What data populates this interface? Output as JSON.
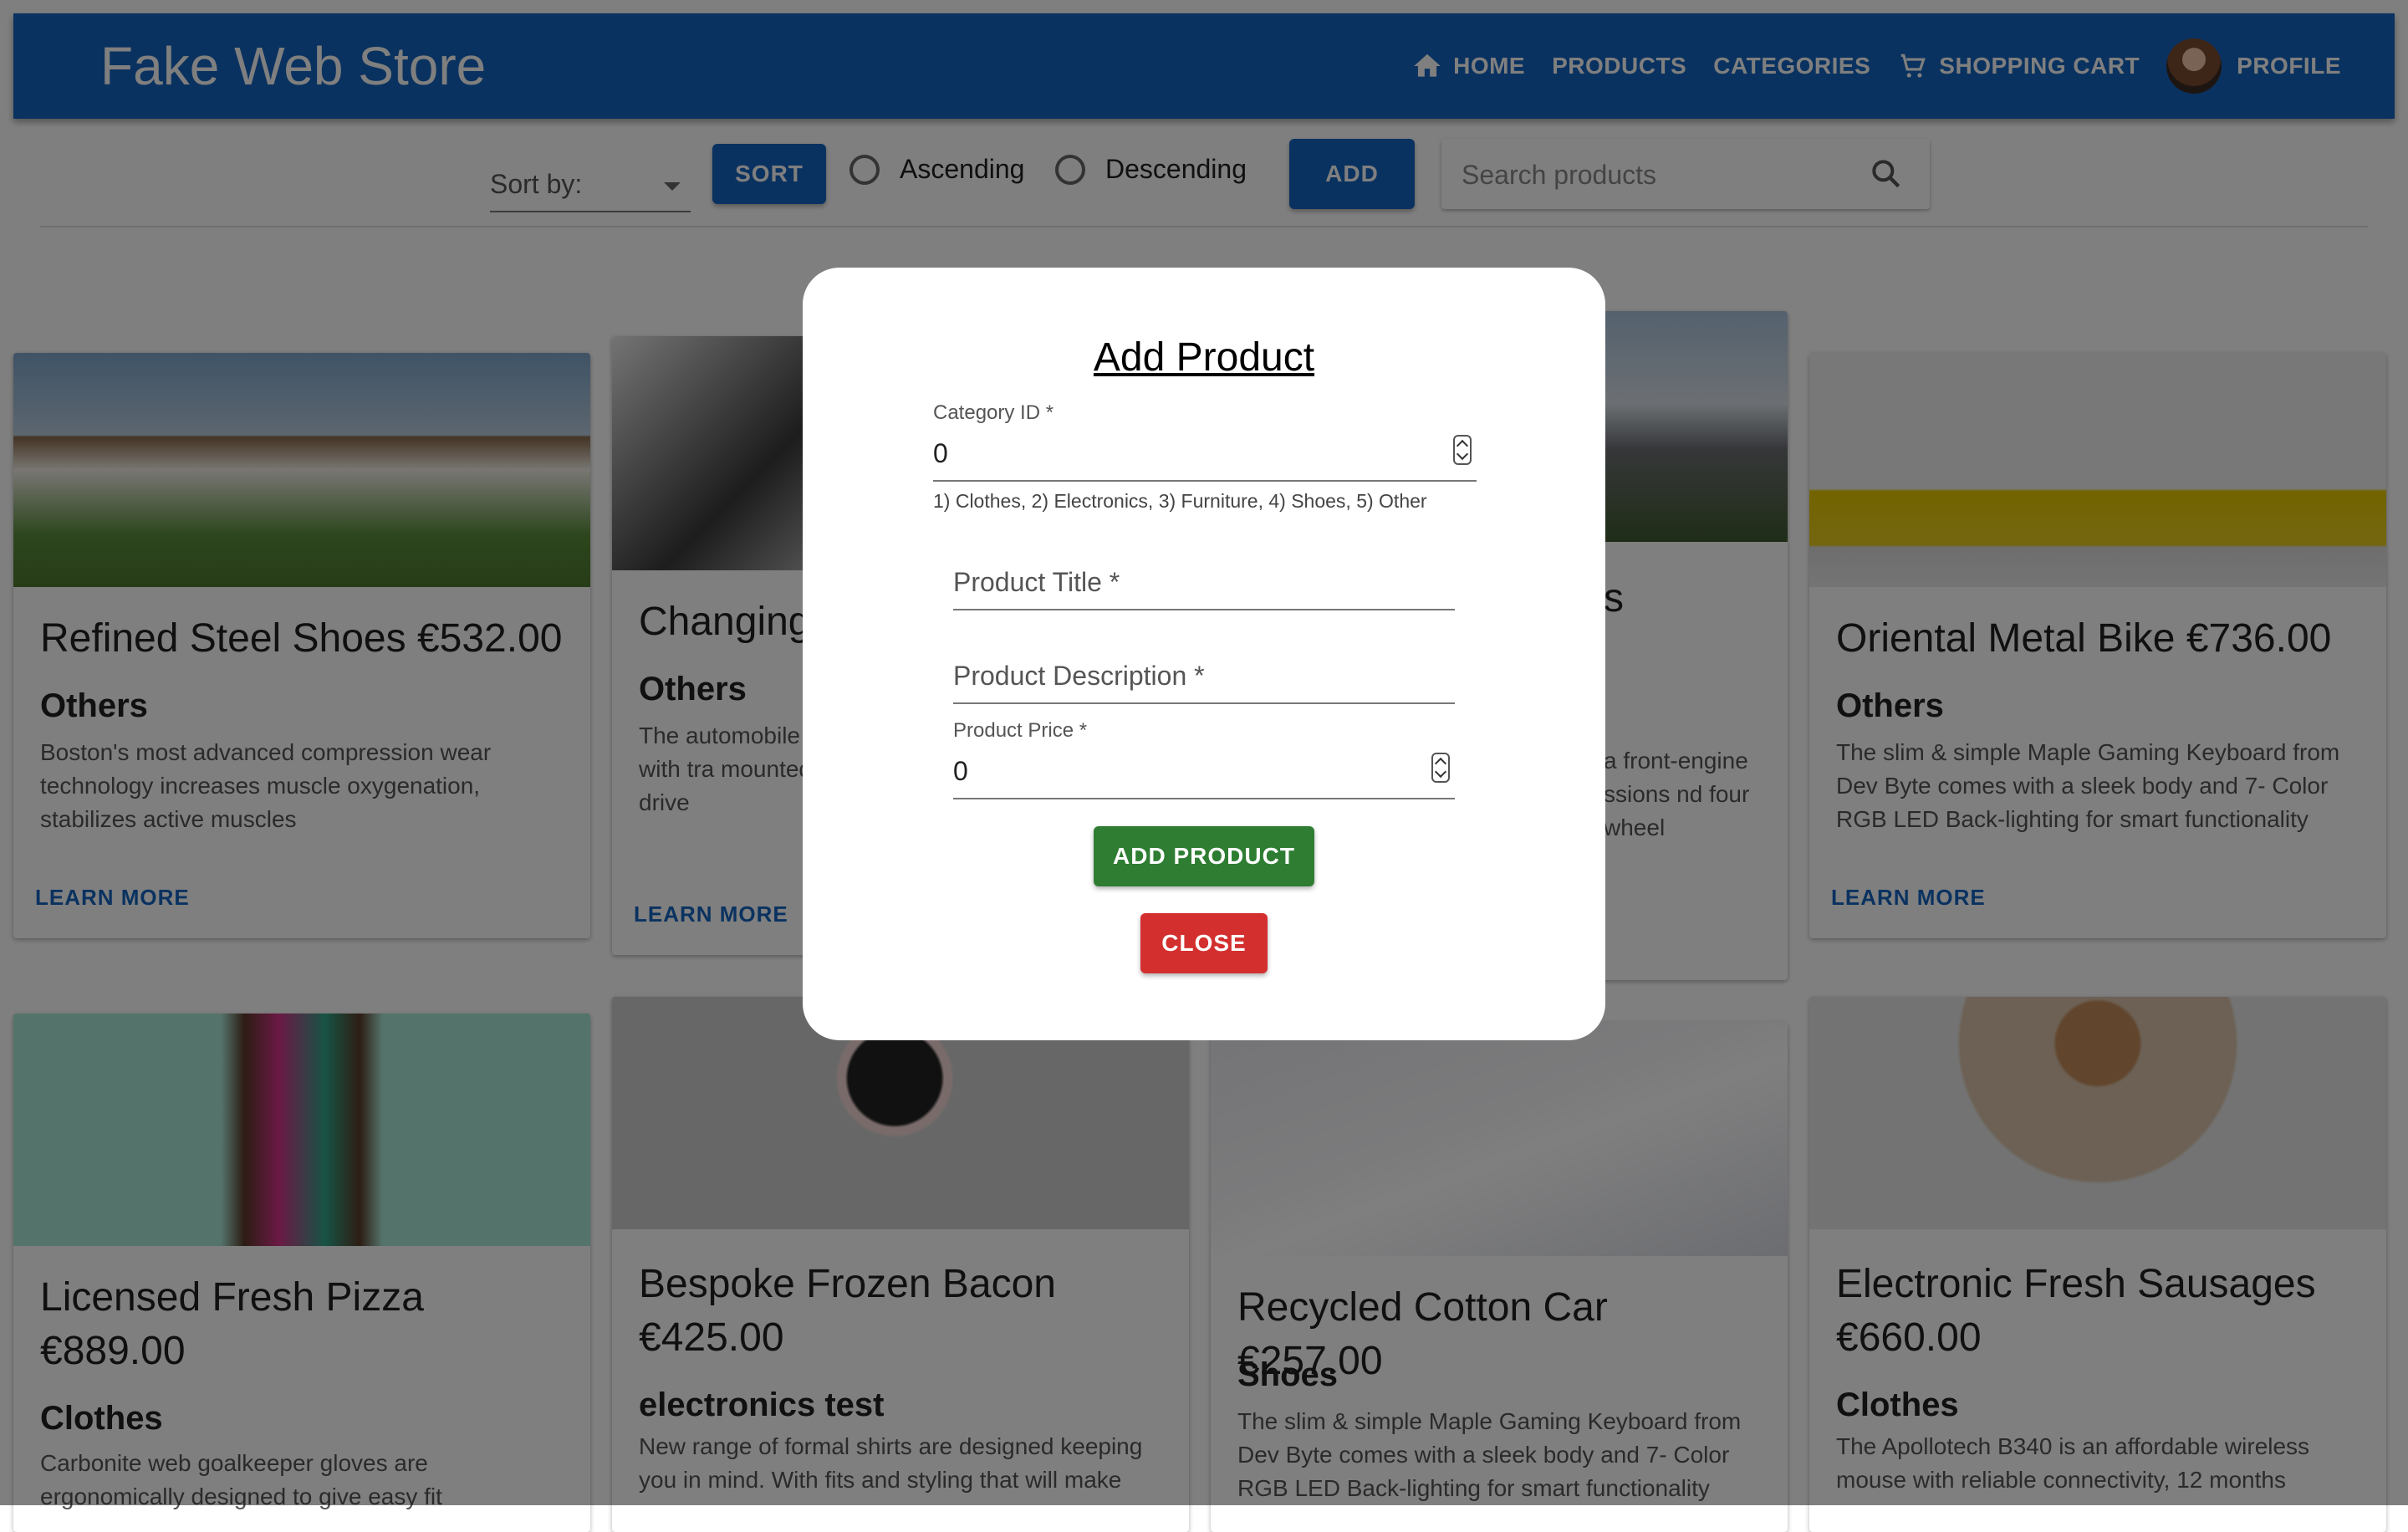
{
  "header": {
    "brand": "Fake Web Store",
    "nav": {
      "home": "HOME",
      "products": "PRODUCTS",
      "categories": "CATEGORIES",
      "cart": "SHOPPING CART",
      "profile": "PROFILE"
    },
    "icons": [
      "home-icon",
      "cart-icon",
      "avatar"
    ]
  },
  "toolbar": {
    "sort_by_label": "Sort by:",
    "sort_button": "SORT",
    "ascending": "Ascending",
    "descending": "Descending",
    "add_button": "ADD",
    "search_placeholder": "Search products"
  },
  "cards": [
    {
      "title": "Refined Steel Shoes €532.00",
      "category": "Others",
      "description": "Boston's most advanced compression wear technology increases muscle oxygenation, stabilizes active muscles",
      "action": "LEARN MORE"
    },
    {
      "title": "Changing",
      "category": "Others",
      "description": "The automobile design, with tra mounted at the drive",
      "action": "LEARN MORE"
    },
    {
      "title": "s",
      "category": "",
      "description": "a front-engine ssions nd four wheel",
      "action": ""
    },
    {
      "title": "Oriental Metal Bike €736.00",
      "category": "Others",
      "description": "The slim & simple Maple Gaming Keyboard from Dev Byte comes with a sleek body and 7- Color RGB LED Back-lighting for smart functionality",
      "action": "LEARN MORE"
    },
    {
      "title": "Licensed Fresh Pizza €889.00",
      "category": "Clothes",
      "description": "Carbonite web goalkeeper gloves are ergonomically designed to give easy fit",
      "action": ""
    },
    {
      "title": "Bespoke Frozen Bacon €425.00",
      "category": "electronics test",
      "description": "New range of formal shirts are designed keeping you in mind. With fits and styling that will make",
      "action": ""
    },
    {
      "title": "Recycled Cotton Car €257.00",
      "category": "Shoes",
      "description": "The slim & simple Maple Gaming Keyboard from Dev Byte comes with a sleek body and 7- Color RGB LED Back-lighting for smart functionality",
      "action": ""
    },
    {
      "title": "Electronic Fresh Sausages €660.00",
      "category": "Clothes",
      "description": "The Apollotech B340 is an affordable wireless mouse with reliable connectivity, 12 months",
      "action": ""
    }
  ],
  "modal": {
    "title": "Add Product",
    "category_id_label": "Category ID *",
    "category_id_value": "0",
    "category_helper": "1) Clothes, 2) Electronics, 3) Furniture, 4) Shoes, 5) Other",
    "product_title_placeholder": "Product Title *",
    "product_description_placeholder": "Product Description *",
    "product_price_label": "Product Price *",
    "product_price_value": "0",
    "add_product_button": "ADD PRODUCT",
    "close_button": "CLOSE"
  },
  "colors": {
    "primary": "#1565c0",
    "success": "#2e7d32",
    "danger": "#d32f2f"
  }
}
